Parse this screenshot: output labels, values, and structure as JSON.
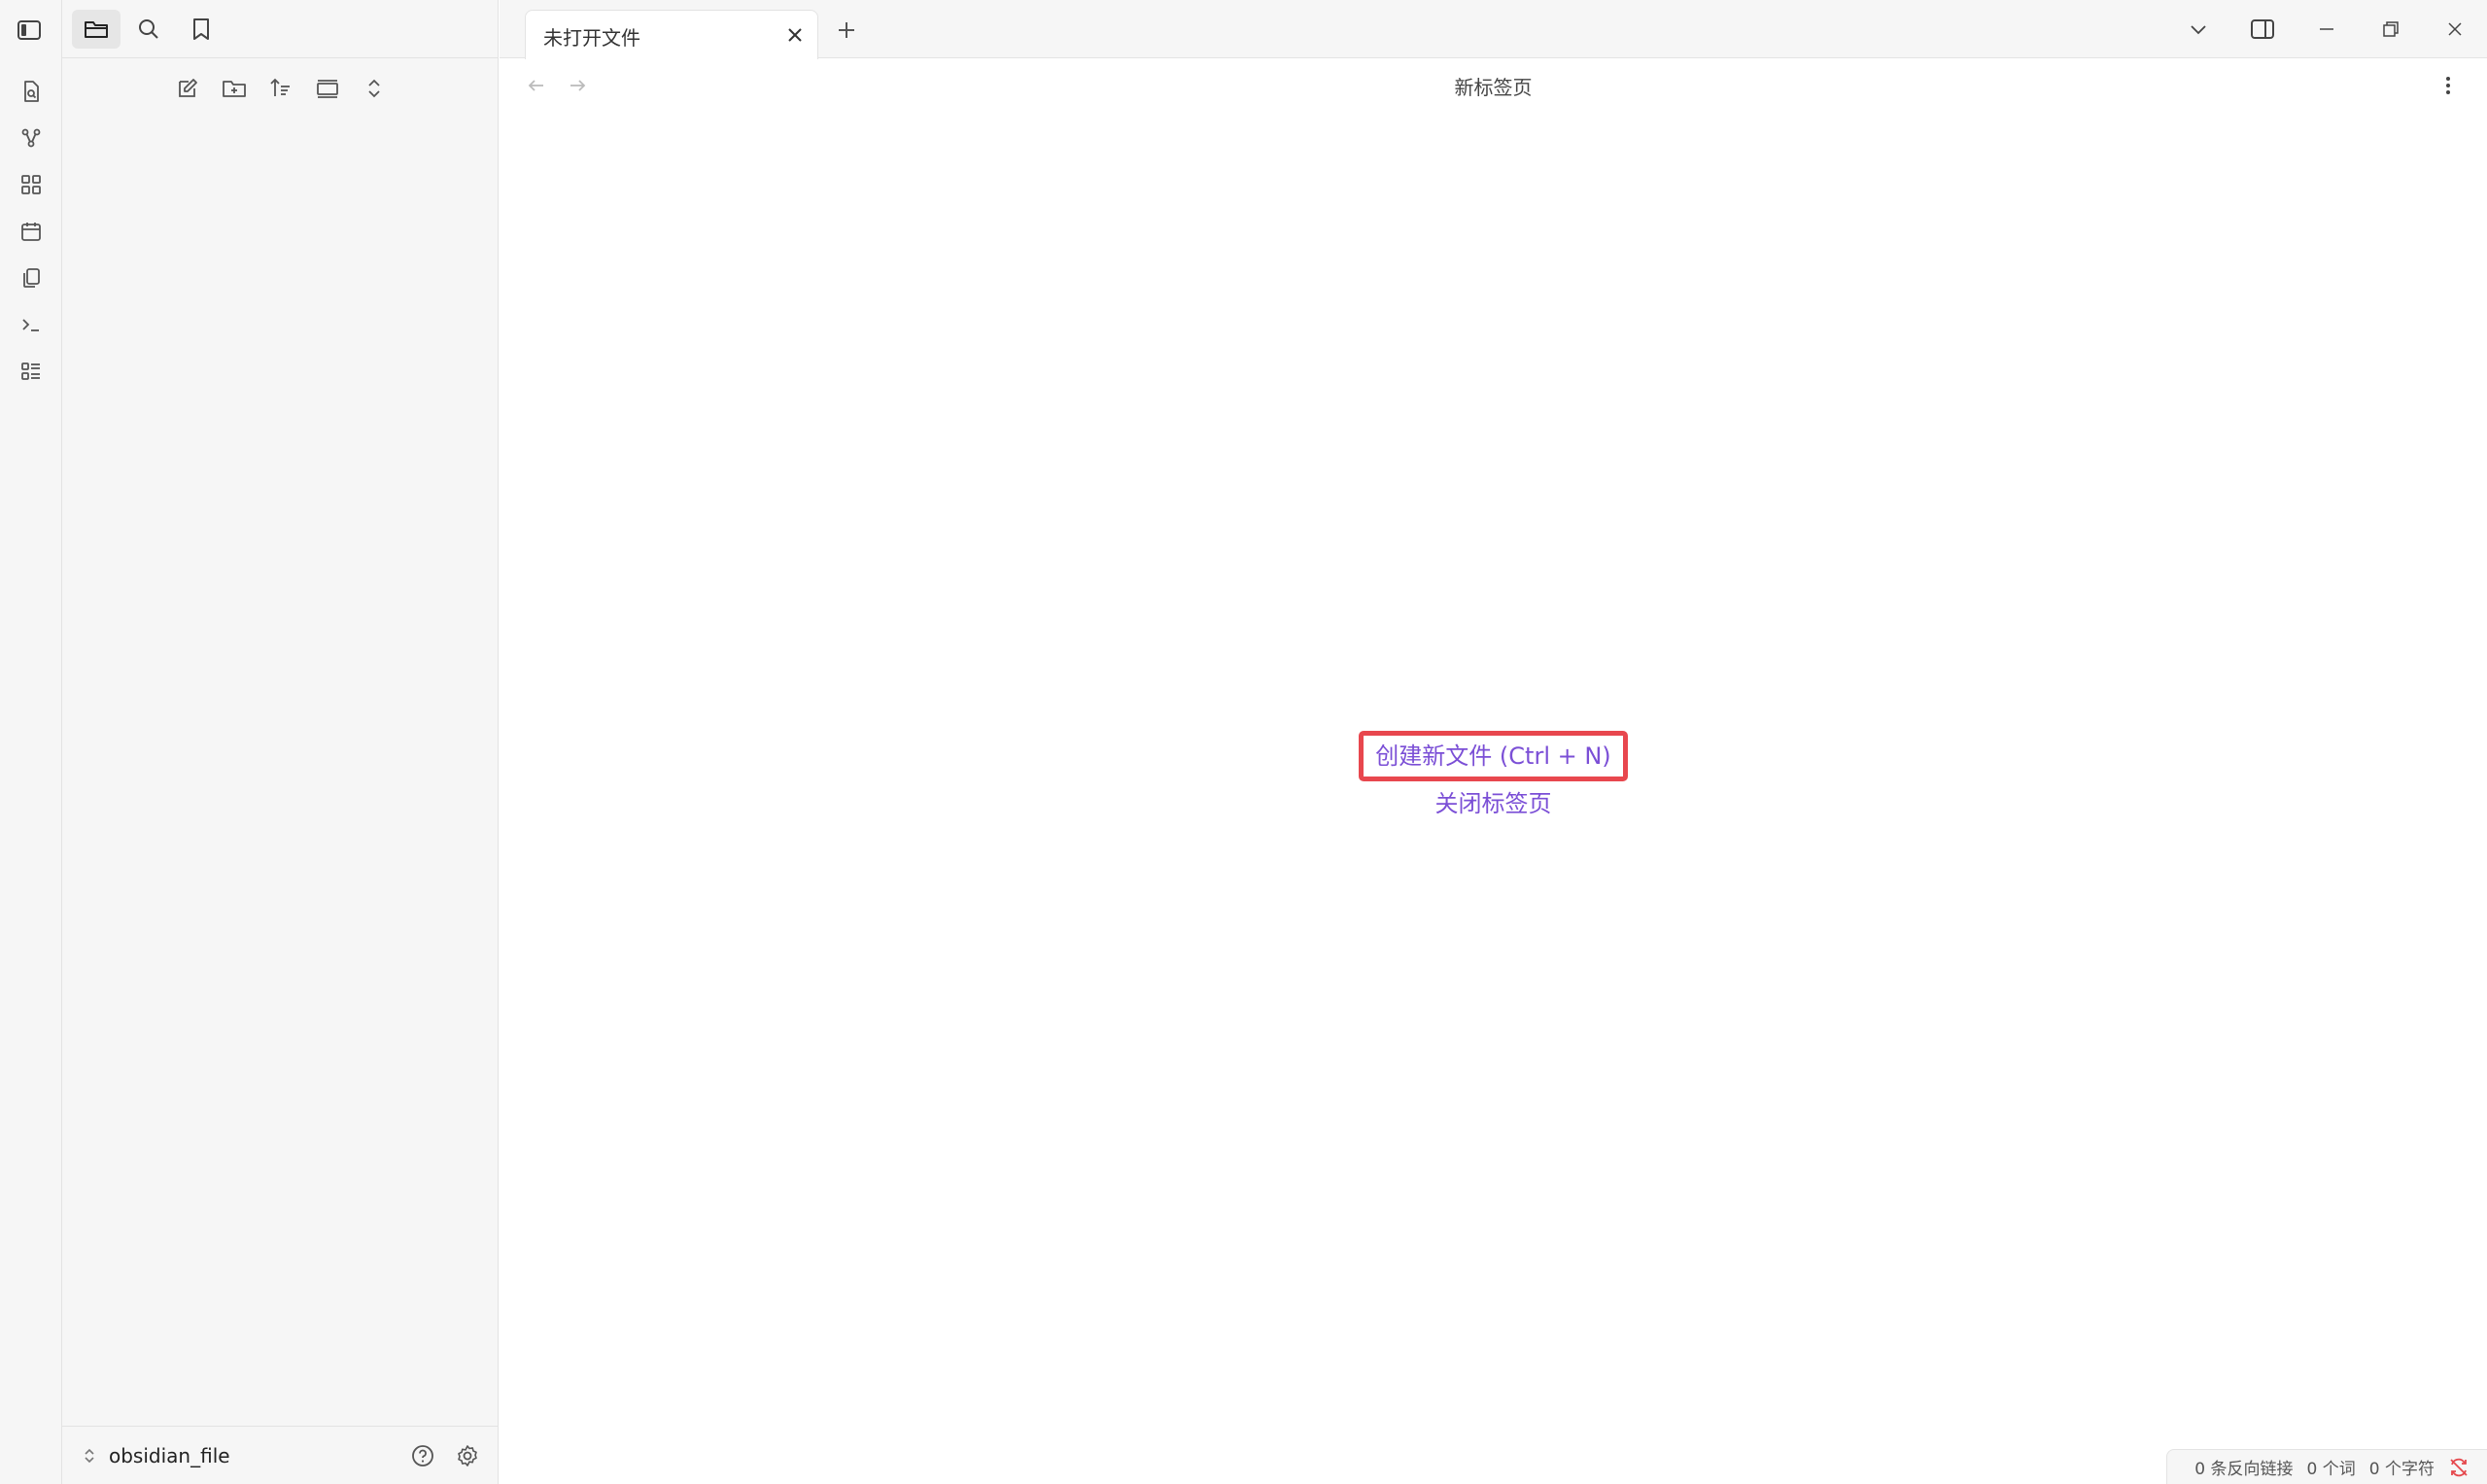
{
  "ribbon": {
    "items": [
      {
        "icon": "file-search-icon"
      },
      {
        "icon": "graph-icon"
      },
      {
        "icon": "canvas-icon"
      },
      {
        "icon": "calendar-icon"
      },
      {
        "icon": "copy-icon"
      },
      {
        "icon": "terminal-icon"
      },
      {
        "icon": "list-icon"
      }
    ]
  },
  "sidebar": {
    "vault_name": "obsidian_file"
  },
  "tabs": [
    {
      "title": "未打开文件",
      "active": true
    }
  ],
  "view": {
    "title": "新标签页"
  },
  "empty_state": {
    "create_file": "创建新文件 (Ctrl + N)",
    "close_tab": "关闭标签页"
  },
  "status": {
    "backlinks": "0 条反向链接",
    "words": "0 个词",
    "chars": "0 个字符"
  },
  "colors": {
    "accent": "#7b4fd6",
    "highlight": "#e8474e",
    "sync_error": "#e5484d"
  }
}
